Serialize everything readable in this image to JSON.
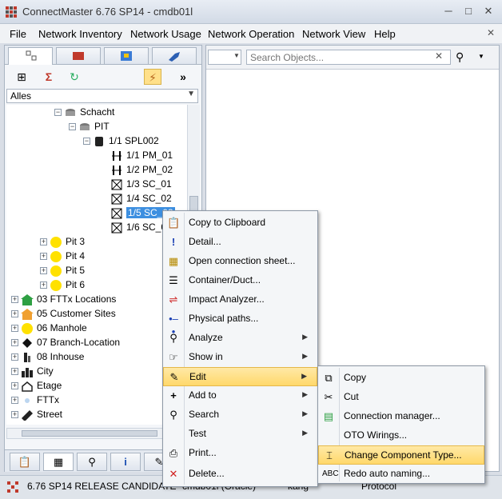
{
  "window": {
    "title": "ConnectMaster 6.76 SP14 - cmdb01l"
  },
  "menubar": [
    "File",
    "Network Inventory",
    "Network Usage",
    "Network Operation",
    "Network View",
    "Help"
  ],
  "left_panel": {
    "filter_value": "Alles",
    "tree": [
      {
        "label": "Schacht"
      },
      {
        "label": "PIT"
      },
      {
        "label": "1/1 SPL002"
      },
      {
        "label": "1/1 PM_01"
      },
      {
        "label": "1/2 PM_02"
      },
      {
        "label": "1/3 SC_01"
      },
      {
        "label": "1/4 SC_02"
      },
      {
        "label": "1/5 SC_03"
      },
      {
        "label": "1/6 SC_04"
      },
      {
        "label": "Pit 3"
      },
      {
        "label": "Pit 4"
      },
      {
        "label": "Pit 5"
      },
      {
        "label": "Pit 6"
      },
      {
        "label": "03 FTTx Locations"
      },
      {
        "label": "05 Customer Sites"
      },
      {
        "label": "06 Manhole"
      },
      {
        "label": "07 Branch-Location"
      },
      {
        "label": "08 Inhouse"
      },
      {
        "label": "City"
      },
      {
        "label": "Etage"
      },
      {
        "label": "FTTx"
      },
      {
        "label": "Street"
      }
    ]
  },
  "right_panel": {
    "search_placeholder": "Search Objects..."
  },
  "statusbar": {
    "version": "6.76 SP14 RELEASE CANDIDATE",
    "db": "cmdb01l (Oracle)",
    "user": "kang",
    "protocol": "Protocol"
  },
  "context_menu": {
    "items": [
      {
        "label": "Copy to Clipboard",
        "icon": "clipboard-icon"
      },
      {
        "label": "Detail...",
        "icon": "info-icon"
      },
      {
        "label": "Open connection sheet...",
        "icon": "table-icon"
      },
      {
        "label": "Container/Duct...",
        "icon": "container-icon"
      },
      {
        "label": "Impact Analyzer...",
        "icon": "impact-icon"
      },
      {
        "label": "Physical paths...",
        "icon": "path-icon"
      },
      {
        "label": "Analyze",
        "icon": "magnifier-icon"
      },
      {
        "label": "Show in",
        "icon": "pointer-icon"
      },
      {
        "label": "Edit",
        "icon": "edit-icon"
      },
      {
        "label": "Add to",
        "icon": "plus-icon"
      },
      {
        "label": "Search",
        "icon": "binoculars-icon"
      },
      {
        "label": "Test",
        "icon": "blank"
      },
      {
        "label": "Print...",
        "icon": "printer-icon"
      },
      {
        "label": "Delete...",
        "icon": "delete-icon"
      }
    ]
  },
  "submenu": {
    "items": [
      {
        "label": "Copy"
      },
      {
        "label": "Cut"
      },
      {
        "label": "Connection manager..."
      },
      {
        "label": "OTO Wirings..."
      },
      {
        "label": "Change Component Type..."
      },
      {
        "label": "Redo auto naming..."
      }
    ]
  }
}
